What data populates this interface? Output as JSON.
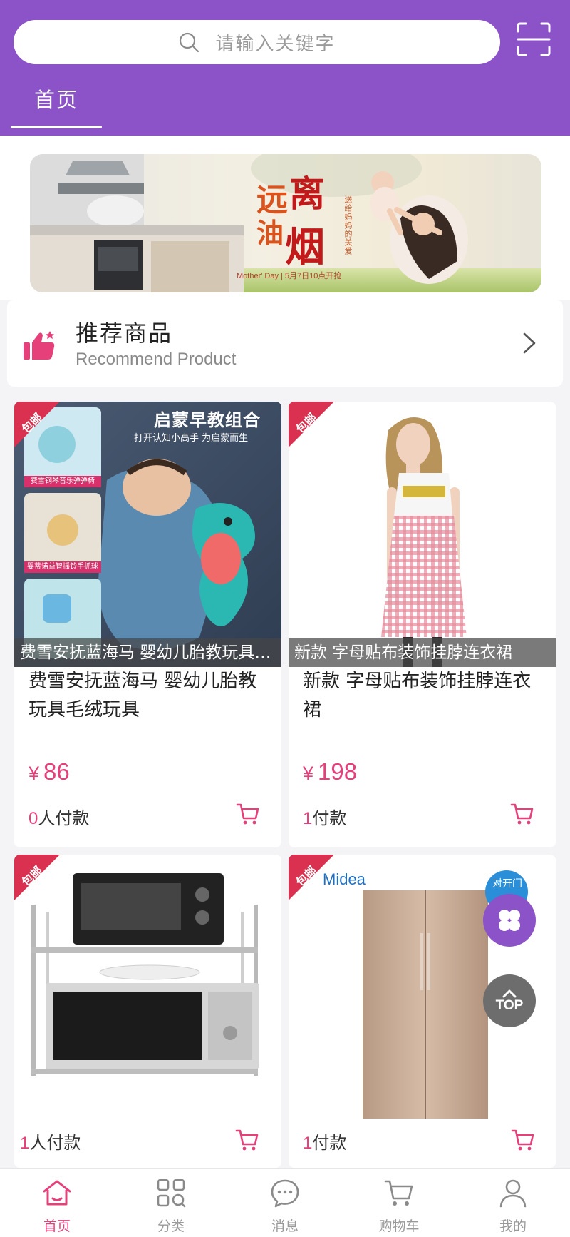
{
  "search": {
    "placeholder": "请输入关键字"
  },
  "tabs": [
    {
      "label": "首页",
      "active": true
    }
  ],
  "banner": {
    "chars": [
      "远",
      "离",
      "油",
      "烟"
    ],
    "side_text": "送给妈妈的关爱",
    "date_text": "Mother' Day | 5月7日10点开抢"
  },
  "recommend": {
    "title": "推荐商品",
    "subtitle": "Recommend Product"
  },
  "ribbon_text": "包邮",
  "products": [
    {
      "caption": "费雪安抚蓝海马 婴幼儿胎教玩具毛绒玩具",
      "name": "费雪安抚蓝海马 婴幼儿胎教玩具毛绒玩具",
      "currency": "¥",
      "price": "86",
      "sold_num": "0",
      "sold_text": "人付款",
      "image_title": "启蒙早教组合",
      "image_sub": "打开认知小高手  为启蒙而生",
      "image_thumb_labels": [
        "费雪钢琴音乐弹弹椅",
        "婴蒂诺益智摇铃手抓球",
        ""
      ]
    },
    {
      "caption": "新款 字母贴布装饰挂脖连衣裙",
      "name": "新款 字母贴布装饰挂脖连衣裙",
      "currency": "¥",
      "price": "198",
      "sold_num": "1",
      "sold_text": "付款"
    },
    {
      "sold_num": "1",
      "sold_text": "人付款"
    },
    {
      "sold_num": "1",
      "sold_text": "付款",
      "brand": "Midea",
      "badge": "对开门"
    }
  ],
  "fab": {
    "top_label": "TOP"
  },
  "bottom_nav": [
    {
      "label": "首页",
      "icon": "home-icon",
      "active": true
    },
    {
      "label": "分类",
      "icon": "category-icon",
      "active": false
    },
    {
      "label": "消息",
      "icon": "message-icon",
      "active": false
    },
    {
      "label": "购物车",
      "icon": "cart-icon",
      "active": false
    },
    {
      "label": "我的",
      "icon": "user-icon",
      "active": false
    }
  ],
  "colors": {
    "brand_purple": "#8c52c8",
    "accent_pink": "#e5407a",
    "ribbon_red": "#d9314f"
  }
}
